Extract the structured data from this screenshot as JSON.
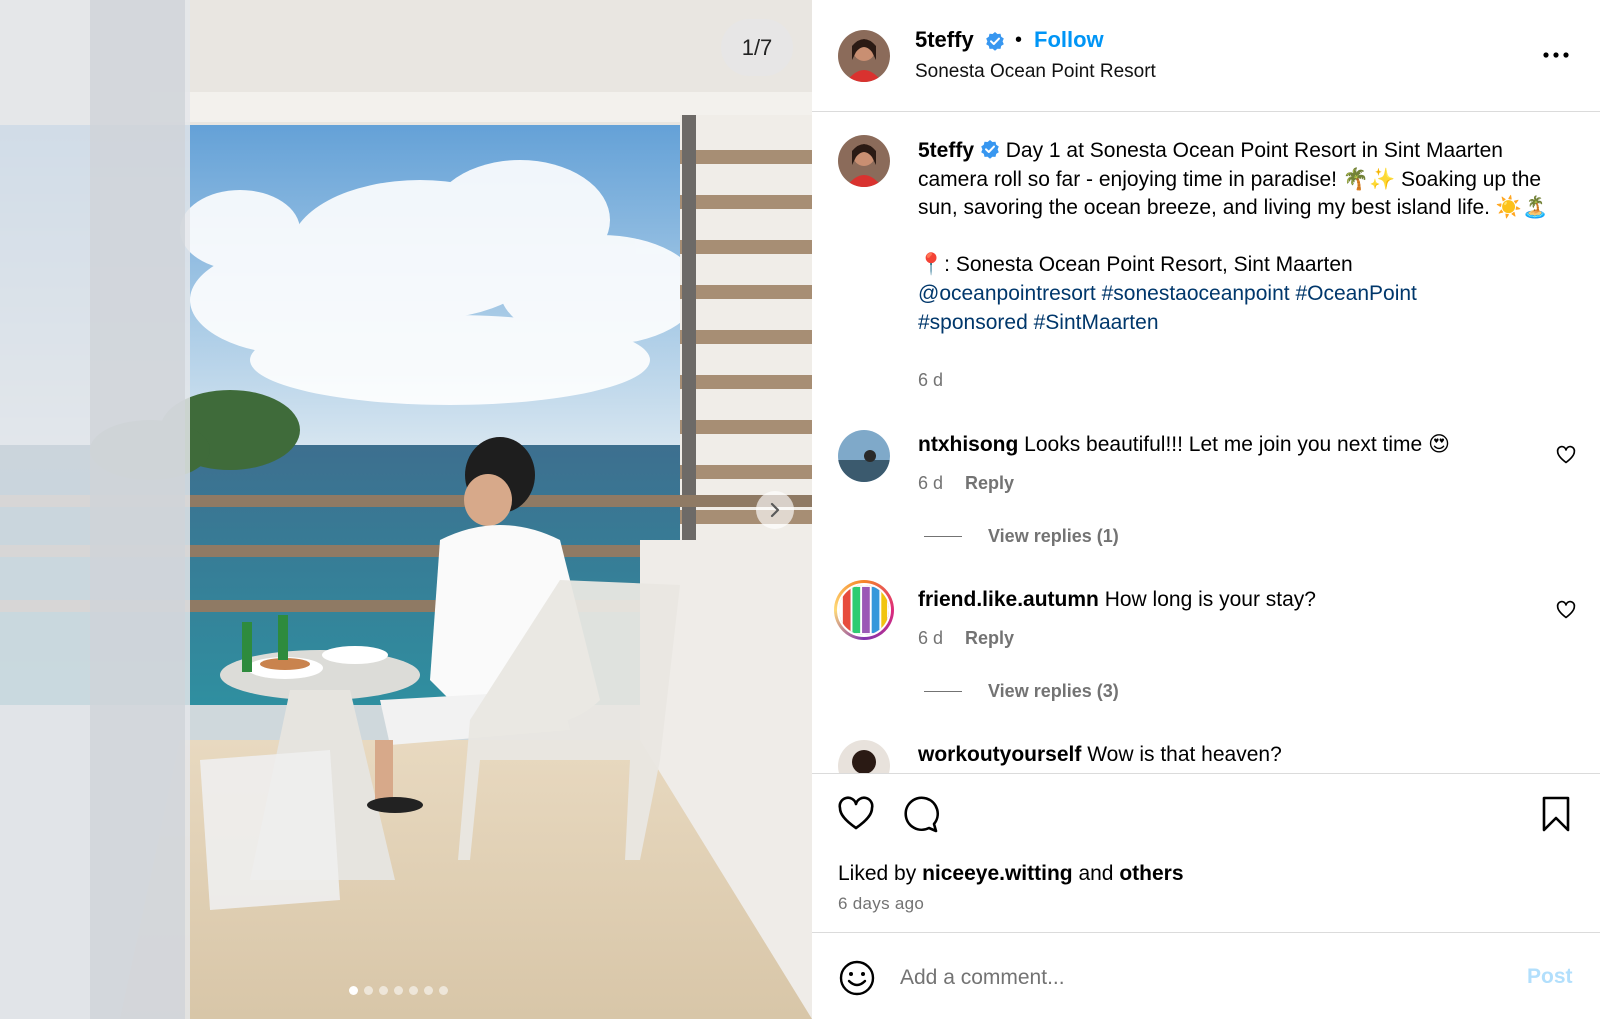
{
  "media": {
    "counter": "1/7",
    "dots_total": 7,
    "dots_active_index": 0
  },
  "post": {
    "username": "5teffy",
    "dot_separator": "•",
    "follow_label": "Follow",
    "location": "Sonesta Ocean Point Resort",
    "caption": {
      "text_line": "Day 1 at Sonesta Ocean Point Resort in Sint Maarten camera roll so far - enjoying time in paradise! 🌴✨ Soaking up the sun, savoring the ocean breeze, and living my best island life. ☀️🏝️",
      "location_line": "📍: Sonesta Ocean Point Resort, Sint Maarten",
      "tags": [
        "@oceanpointresort",
        "#sonestaoceanpoint",
        "#OceanPoint",
        "#sponsored",
        "#SintMaarten"
      ],
      "time": "6 d"
    },
    "comments": [
      {
        "username": "ntxhisong",
        "text": "Looks beautiful!!! Let me join you next time 😍",
        "time": "6 d",
        "reply_label": "Reply",
        "view_replies": "View replies (1)"
      },
      {
        "username": "friend.like.autumn",
        "text": "How long is your stay?",
        "time": "6 d",
        "reply_label": "Reply",
        "view_replies": "View replies (3)"
      },
      {
        "username": "workoutyourself",
        "text": "Wow is that heaven?"
      }
    ],
    "liked_by": {
      "prefix": "Liked by",
      "user": "niceeye.witting",
      "and": "and",
      "others": "others"
    },
    "timestamp": "6 days ago",
    "add_comment": {
      "placeholder": "Add a comment...",
      "post_label": "Post"
    }
  },
  "colors": {
    "accent_blue": "#0095f6",
    "hashtag": "#00376b",
    "muted": "#737373",
    "post_disabled": "#b2dffc",
    "verified_badge": "#3897f0"
  }
}
